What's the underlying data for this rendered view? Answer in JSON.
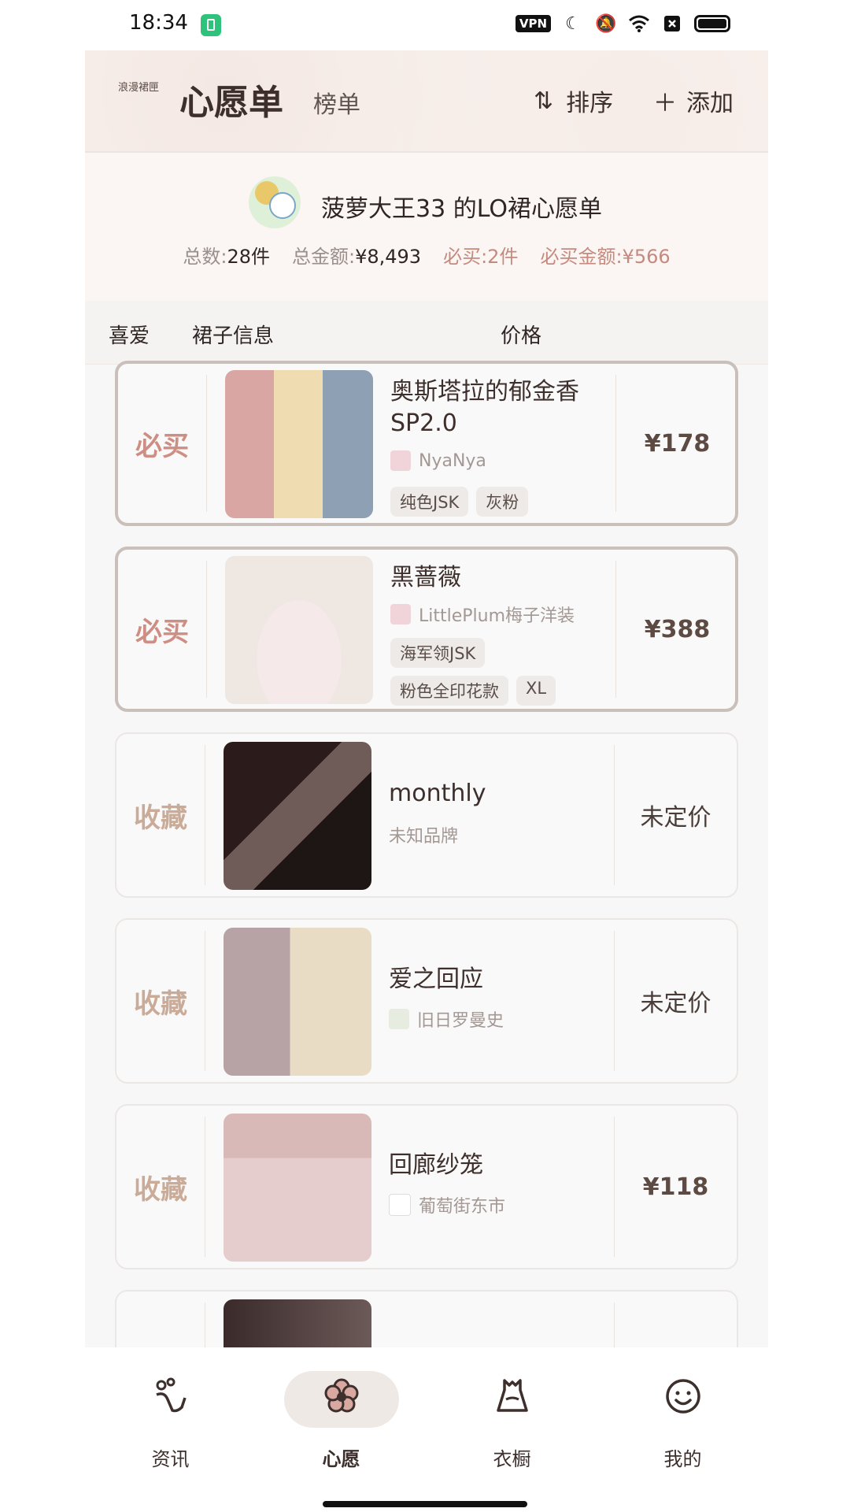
{
  "status": {
    "time": "18:34",
    "vpn": "VPN"
  },
  "header": {
    "logo_text": "浪漫裙匣",
    "title": "心愿单",
    "rank": "榜单",
    "sort": "排序",
    "add": "添加"
  },
  "summary": {
    "owner": "菠萝大王33 的LO裙心愿单",
    "total_label": "总数:",
    "total_value": "28件",
    "amount_label": "总金额:",
    "amount_value": "¥8,493",
    "must_label": "必买:",
    "must_value": "2件",
    "must_amount_label": "必买金额:",
    "must_amount_value": "¥566"
  },
  "columns": {
    "like": "喜爱",
    "info": "裙子信息",
    "price": "价格"
  },
  "items": [
    {
      "tag": "必买",
      "name": "奥斯塔拉的郁金香SP2.0",
      "brand": "NyaNya",
      "tags": [
        "纯色JSK",
        "灰粉"
      ],
      "price": "¥178"
    },
    {
      "tag": "必买",
      "name": "黑蔷薇",
      "brand": "LittlePlum梅子洋装",
      "tags": [
        "海军领JSK",
        "粉色全印花款",
        "XL"
      ],
      "price": "¥388"
    },
    {
      "tag": "收藏",
      "name": "monthly",
      "brand": "未知品牌",
      "tags": [],
      "price": "未定价"
    },
    {
      "tag": "收藏",
      "name": "爱之回应",
      "brand": "旧日罗曼史",
      "tags": [],
      "price": "未定价"
    },
    {
      "tag": "收藏",
      "name": "回廊纱笼",
      "brand": "葡萄街东市",
      "tags": [],
      "price": "¥118"
    }
  ],
  "nav": [
    {
      "label": "资讯",
      "icon": "news-icon"
    },
    {
      "label": "心愿",
      "icon": "flower-icon"
    },
    {
      "label": "衣橱",
      "icon": "wardrobe-icon"
    },
    {
      "label": "我的",
      "icon": "smile-icon"
    }
  ],
  "colors": {
    "must": "#cd8e84",
    "fav": "#c9ab98",
    "accent": "#c58a7e"
  }
}
